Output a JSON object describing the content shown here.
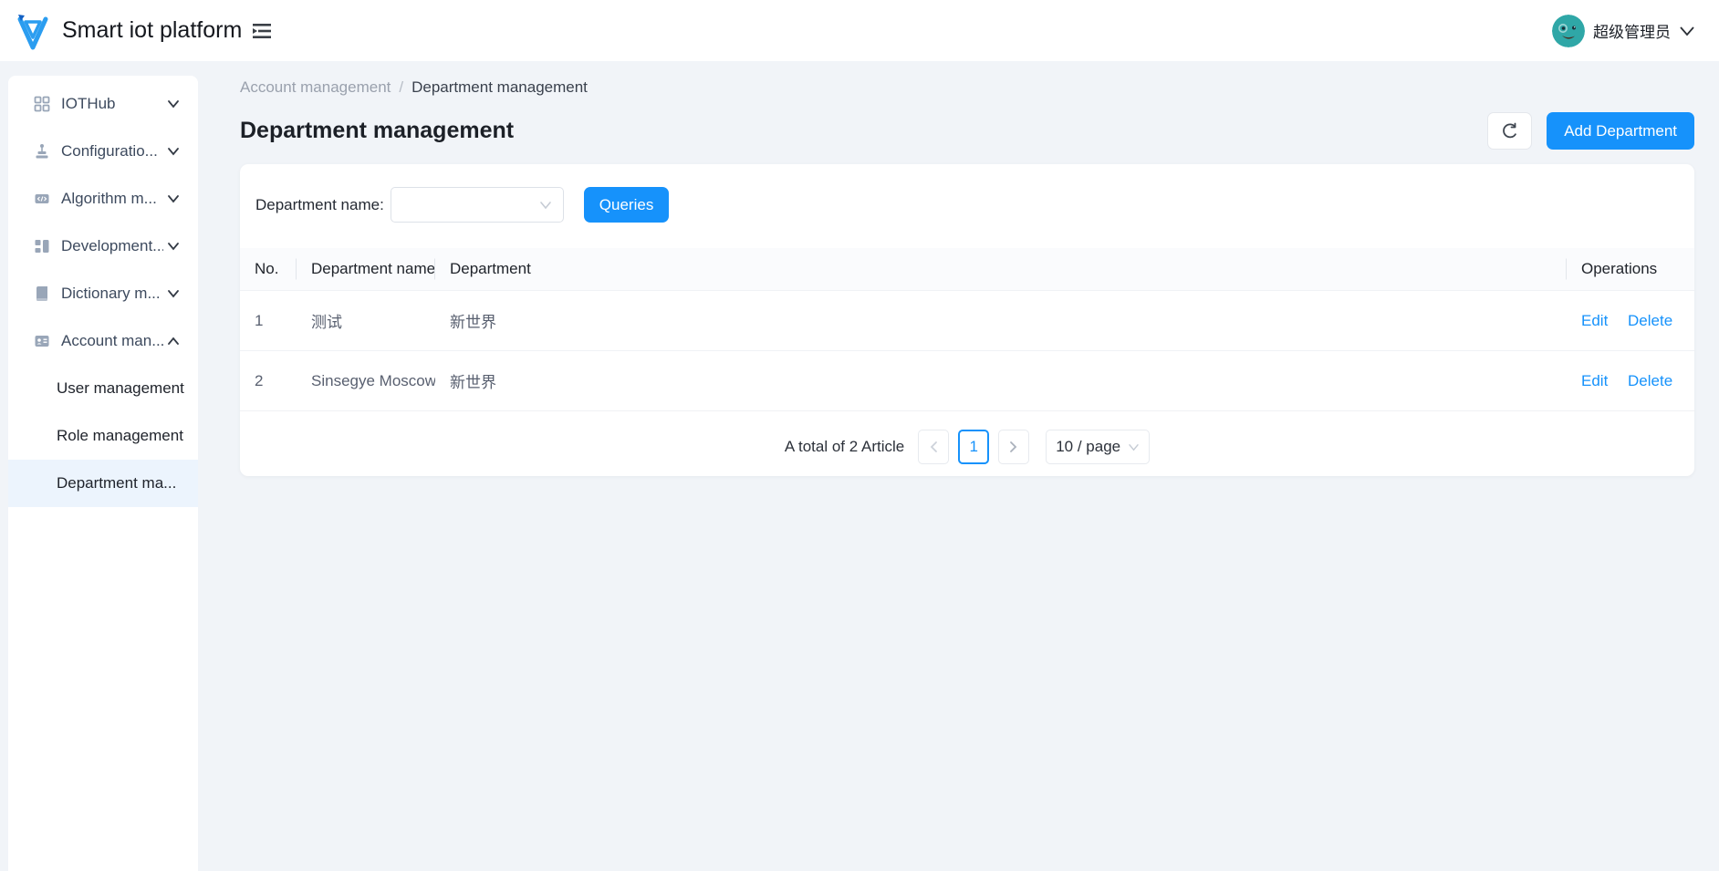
{
  "header": {
    "app_title": "Smart iot platform",
    "user_name": "超级管理员"
  },
  "sidebar": {
    "menu": [
      {
        "label": "IOTHub",
        "icon": "grid-icon",
        "state": "collapsed"
      },
      {
        "label": "Configuratio...",
        "icon": "config-icon",
        "state": "collapsed"
      },
      {
        "label": "Algorithm m...",
        "icon": "code-icon",
        "state": "collapsed"
      },
      {
        "label": "Development...",
        "icon": "blocks-icon",
        "state": "collapsed"
      },
      {
        "label": "Dictionary m...",
        "icon": "book-icon",
        "state": "collapsed"
      },
      {
        "label": "Account man...",
        "icon": "id-card-icon",
        "state": "expanded"
      }
    ],
    "submenu": [
      {
        "label": "User management",
        "active": false
      },
      {
        "label": "Role management",
        "active": false
      },
      {
        "label": "Department ma...",
        "active": true
      }
    ]
  },
  "breadcrumb": {
    "parent": "Account management",
    "separator": "/",
    "current": "Department management"
  },
  "page": {
    "title": "Department management",
    "add_button": "Add Department"
  },
  "filter": {
    "label": "Department name:",
    "select_value": "",
    "query_button": "Queries"
  },
  "table": {
    "columns": {
      "no": "No.",
      "name": "Department name",
      "department": "Department",
      "operations": "Operations"
    },
    "edit_label": "Edit",
    "delete_label": "Delete",
    "rows": [
      {
        "no": "1",
        "name": "测试",
        "department": "新世界"
      },
      {
        "no": "2",
        "name": "Sinsegye Moscow",
        "department": "新世界"
      }
    ]
  },
  "pagination": {
    "total_text": "A total of 2 Article",
    "current_page": "1",
    "page_size": "10 / page"
  },
  "colors": {
    "primary": "#1692fb",
    "sidebar_active_bg": "#ecf4fd",
    "page_background": "#f1f4f8",
    "avatar_background": "#2fa7a7"
  }
}
